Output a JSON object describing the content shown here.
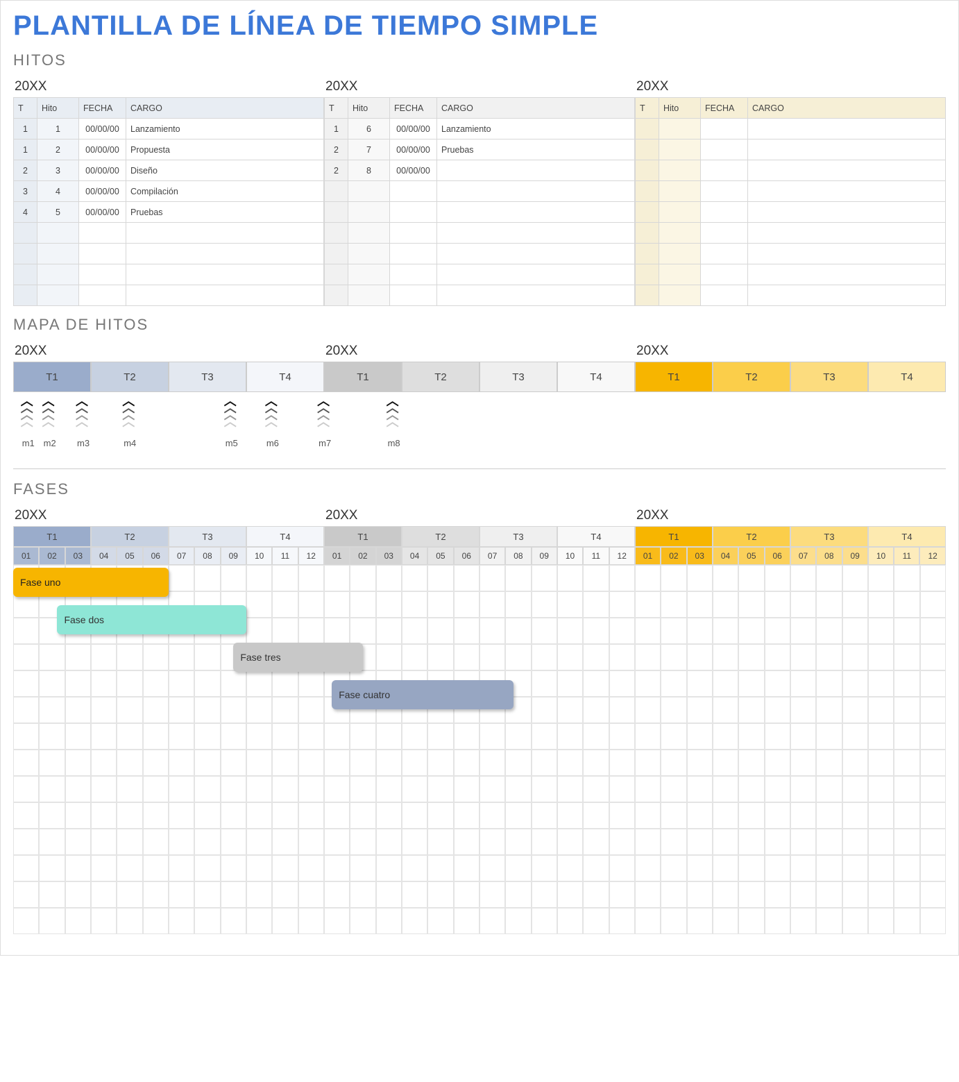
{
  "title": "PLANTILLA DE LÍNEA DE TIEMPO SIMPLE",
  "sections": {
    "hitos": "HITOS",
    "mapa": "MAPA DE HITOS",
    "fases": "FASES"
  },
  "years": [
    "20XX",
    "20XX",
    "20XX"
  ],
  "hitos_headers": {
    "t": "T",
    "hito": "Hito",
    "fecha": "FECHA",
    "cargo": "CARGO"
  },
  "hitos": {
    "year1": [
      {
        "t": "1",
        "hito": "1",
        "fecha": "00/00/00",
        "cargo": "Lanzamiento"
      },
      {
        "t": "1",
        "hito": "2",
        "fecha": "00/00/00",
        "cargo": "Propuesta"
      },
      {
        "t": "2",
        "hito": "3",
        "fecha": "00/00/00",
        "cargo": "Diseño"
      },
      {
        "t": "3",
        "hito": "4",
        "fecha": "00/00/00",
        "cargo": "Compilación"
      },
      {
        "t": "4",
        "hito": "5",
        "fecha": "00/00/00",
        "cargo": "Pruebas"
      },
      {
        "t": "",
        "hito": "",
        "fecha": "",
        "cargo": ""
      },
      {
        "t": "",
        "hito": "",
        "fecha": "",
        "cargo": ""
      },
      {
        "t": "",
        "hito": "",
        "fecha": "",
        "cargo": ""
      },
      {
        "t": "",
        "hito": "",
        "fecha": "",
        "cargo": ""
      }
    ],
    "year2": [
      {
        "t": "1",
        "hito": "6",
        "fecha": "00/00/00",
        "cargo": "Lanzamiento"
      },
      {
        "t": "2",
        "hito": "7",
        "fecha": "00/00/00",
        "cargo": "Pruebas"
      },
      {
        "t": "2",
        "hito": "8",
        "fecha": "00/00/00",
        "cargo": ""
      },
      {
        "t": "",
        "hito": "",
        "fecha": "",
        "cargo": ""
      },
      {
        "t": "",
        "hito": "",
        "fecha": "",
        "cargo": ""
      },
      {
        "t": "",
        "hito": "",
        "fecha": "",
        "cargo": ""
      },
      {
        "t": "",
        "hito": "",
        "fecha": "",
        "cargo": ""
      },
      {
        "t": "",
        "hito": "",
        "fecha": "",
        "cargo": ""
      },
      {
        "t": "",
        "hito": "",
        "fecha": "",
        "cargo": ""
      }
    ],
    "year3": [
      {
        "t": "",
        "hito": "",
        "fecha": "",
        "cargo": ""
      },
      {
        "t": "",
        "hito": "",
        "fecha": "",
        "cargo": ""
      },
      {
        "t": "",
        "hito": "",
        "fecha": "",
        "cargo": ""
      },
      {
        "t": "",
        "hito": "",
        "fecha": "",
        "cargo": ""
      },
      {
        "t": "",
        "hito": "",
        "fecha": "",
        "cargo": ""
      },
      {
        "t": "",
        "hito": "",
        "fecha": "",
        "cargo": ""
      },
      {
        "t": "",
        "hito": "",
        "fecha": "",
        "cargo": ""
      },
      {
        "t": "",
        "hito": "",
        "fecha": "",
        "cargo": ""
      },
      {
        "t": "",
        "hito": "",
        "fecha": "",
        "cargo": ""
      }
    ]
  },
  "quarters": [
    "T1",
    "T2",
    "T3",
    "T4"
  ],
  "milestone_markers": [
    {
      "label": "m1",
      "left_pct": 0.8
    },
    {
      "label": "m2",
      "left_pct": 3.1
    },
    {
      "label": "m3",
      "left_pct": 6.7
    },
    {
      "label": "m4",
      "left_pct": 11.7
    },
    {
      "label": "m5",
      "left_pct": 22.6
    },
    {
      "label": "m6",
      "left_pct": 27.0
    },
    {
      "label": "m7",
      "left_pct": 32.6
    },
    {
      "label": "m8",
      "left_pct": 40.0
    }
  ],
  "months": [
    "01",
    "02",
    "03",
    "04",
    "05",
    "06",
    "07",
    "08",
    "09",
    "10",
    "11",
    "12"
  ],
  "gantt_rows": 14,
  "phases": [
    {
      "label": "Fase uno",
      "row": 0,
      "start": 0,
      "span": 6,
      "cls": "bar-yellow"
    },
    {
      "label": "Fase dos",
      "row": 1,
      "start": 1.7,
      "span": 7.3,
      "cls": "bar-teal"
    },
    {
      "label": "Fase tres",
      "row": 2,
      "start": 8.5,
      "span": 5,
      "cls": "bar-grey"
    },
    {
      "label": "Fase cuatro",
      "row": 3,
      "start": 12.3,
      "span": 7,
      "cls": "bar-blue"
    }
  ],
  "chart_data": {
    "type": "bar",
    "title": "Fases (Gantt simple, 3 años × 12 meses)",
    "x_range_months": 36,
    "series": [
      {
        "name": "Fase uno",
        "start_month": 1,
        "end_month": 6
      },
      {
        "name": "Fase dos",
        "start_month": 2,
        "end_month": 9
      },
      {
        "name": "Fase tres",
        "start_month": 9,
        "end_month": 14
      },
      {
        "name": "Fase cuatro",
        "start_month": 13,
        "end_month": 19
      }
    ]
  }
}
